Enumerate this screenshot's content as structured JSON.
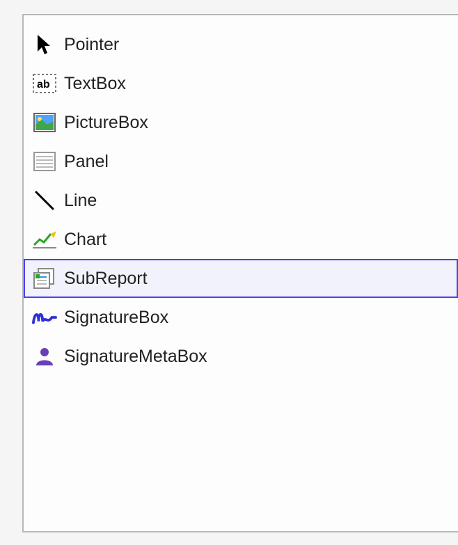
{
  "toolbox": {
    "items": [
      {
        "id": "pointer",
        "label": "Pointer",
        "icon": "pointer-icon",
        "selected": false
      },
      {
        "id": "textbox",
        "label": "TextBox",
        "icon": "textbox-icon",
        "selected": false
      },
      {
        "id": "picturebox",
        "label": "PictureBox",
        "icon": "picturebox-icon",
        "selected": false
      },
      {
        "id": "panel",
        "label": "Panel",
        "icon": "panel-icon",
        "selected": false
      },
      {
        "id": "line",
        "label": "Line",
        "icon": "line-icon",
        "selected": false
      },
      {
        "id": "chart",
        "label": "Chart",
        "icon": "chart-icon",
        "selected": false
      },
      {
        "id": "subreport",
        "label": "SubReport",
        "icon": "subreport-icon",
        "selected": true
      },
      {
        "id": "signaturebox",
        "label": "SignatureBox",
        "icon": "signaturebox-icon",
        "selected": false
      },
      {
        "id": "signaturemetabox",
        "label": "SignatureMetaBox",
        "icon": "signaturemetabox-icon",
        "selected": false
      }
    ]
  }
}
